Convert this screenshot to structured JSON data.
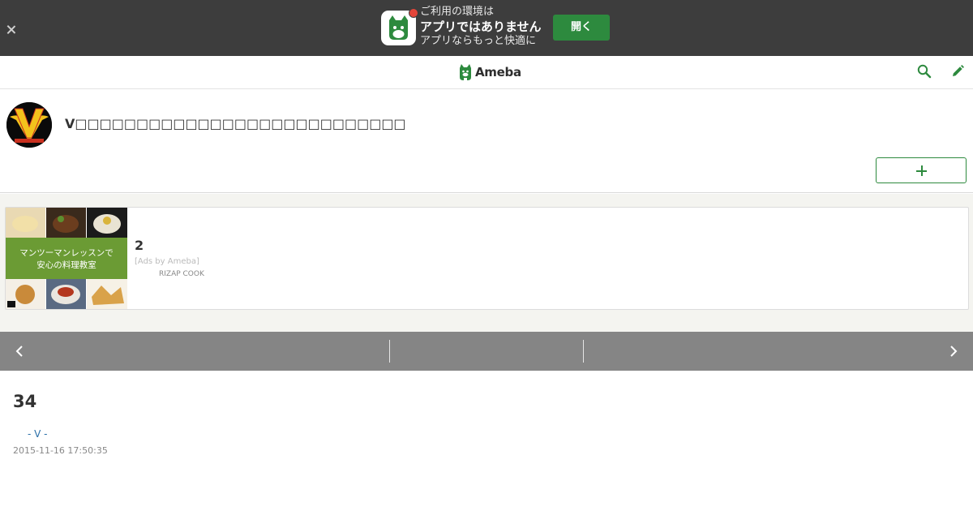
{
  "app_banner": {
    "line1": "ご利用の環境は",
    "line2": "アプリではありません",
    "line3": "アプリならもっと快適に",
    "open_label": "開く"
  },
  "header": {
    "logo_text": "Ameba"
  },
  "profile": {
    "blog_title": "V□□□□□□□□□□□□□□□□□□□□□□□□□□□"
  },
  "ad": {
    "image_line1": "マンツーマンレッスンで",
    "image_line2": "安心の料理教室",
    "title": "2",
    "label": "[Ads by Ameba]",
    "sponsor": "RIZAP COOK"
  },
  "entry": {
    "title": "34",
    "theme": "- V -",
    "date": "2015-11-16 17:50:35"
  },
  "colors": {
    "banner_bg": "#3d3d3d",
    "accent_green": "#2d8a3e",
    "pager_bg": "#858585",
    "link_blue": "#2a6fa8"
  }
}
